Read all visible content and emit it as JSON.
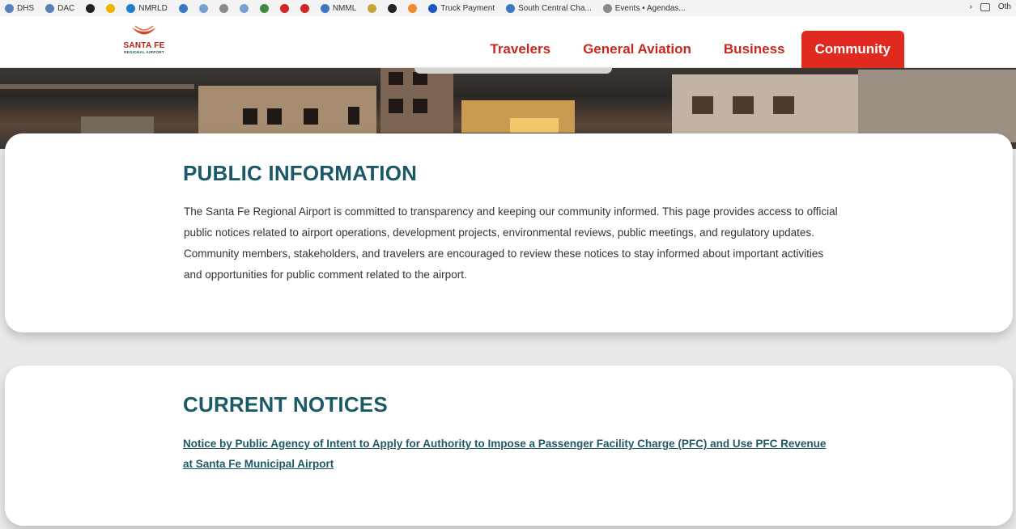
{
  "bookmarks": {
    "items": [
      {
        "label": "DHS",
        "color": "#5b7fb8"
      },
      {
        "label": "DAC",
        "color": "#5b7fb8"
      },
      {
        "label": "",
        "color": "#222222"
      },
      {
        "label": "",
        "color": "#f0b400"
      },
      {
        "label": "NMRLD",
        "color": "#1f7fcf"
      },
      {
        "label": "",
        "color": "#3a78c2"
      },
      {
        "label": "",
        "color": "#7a9fd1"
      },
      {
        "label": "",
        "color": "#8a8a8a"
      },
      {
        "label": "",
        "color": "#7a9fd1"
      },
      {
        "label": "",
        "color": "#3d8c3d"
      },
      {
        "label": "",
        "color": "#d02626"
      },
      {
        "label": "",
        "color": "#d02626"
      },
      {
        "label": "NMML",
        "color": "#3a78c2"
      },
      {
        "label": "",
        "color": "#caa23a"
      },
      {
        "label": "",
        "color": "#222222"
      },
      {
        "label": "",
        "color": "#f08a2a"
      },
      {
        "label": "Truck Payment",
        "color": "#1f57c2"
      },
      {
        "label": "South Central Cha...",
        "color": "#3a78c2"
      },
      {
        "label": "Events • Agendas...",
        "color": "#8a8a8a"
      }
    ],
    "overflow_label": "Oth"
  },
  "header": {
    "logo_text": "SANTA FE",
    "logo_subtext": "REGIONAL AIRPORT",
    "nav": [
      {
        "label": "Travelers",
        "active": false
      },
      {
        "label": "General Aviation",
        "active": false
      },
      {
        "label": "Business",
        "active": false
      },
      {
        "label": "Community",
        "active": true
      }
    ]
  },
  "public_info": {
    "title": "PUBLIC INFORMATION",
    "body": "The Santa Fe Regional Airport is committed to transparency and keeping our community informed. This page provides access to official public notices related to airport operations, development projects, environmental reviews, public meetings, and regulatory updates. Community members, stakeholders, and travelers are encouraged to review these notices to stay informed about important activities and opportunities for public comment related to the airport."
  },
  "current_notices": {
    "title": "CURRENT NOTICES",
    "items": [
      {
        "label": "Notice by Public Agency of Intent to Apply for Authority to Impose a Passenger Facility Charge (PFC) and Use PFC Revenue at  Santa Fe Municipal Airport"
      }
    ]
  },
  "colors": {
    "brand_red": "#e02a1f",
    "heading_teal": "#1a5a66"
  }
}
